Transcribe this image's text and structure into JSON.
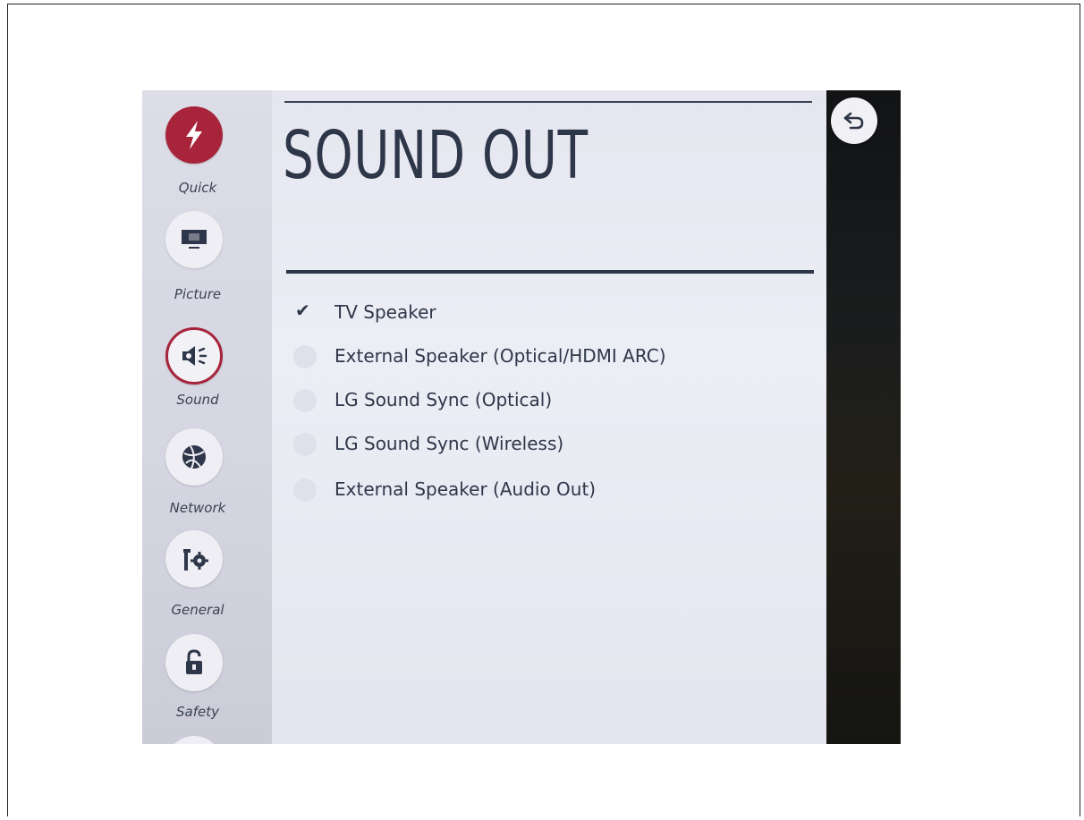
{
  "sidebar": {
    "items": [
      {
        "label": "Quick",
        "icon": "lightning-icon"
      },
      {
        "label": "Picture",
        "icon": "monitor-icon"
      },
      {
        "label": "Sound",
        "icon": "speaker-icon"
      },
      {
        "label": "Network",
        "icon": "globe-icon"
      },
      {
        "label": "General",
        "icon": "wrench-gear-icon"
      },
      {
        "label": "Safety",
        "icon": "lock-icon"
      }
    ],
    "selected": "Sound"
  },
  "panel": {
    "title": "SOUND OUT",
    "options": [
      {
        "label": "TV Speaker",
        "checked": true
      },
      {
        "label": "External Speaker (Optical/HDMI ARC)",
        "checked": false
      },
      {
        "label": "LG Sound Sync (Optical)",
        "checked": false
      },
      {
        "label": "LG Sound Sync (Wireless)",
        "checked": false
      },
      {
        "label": "External Speaker (Audio Out)",
        "checked": false
      }
    ]
  },
  "header": {
    "back_icon": "back-arrow-icon"
  },
  "colors": {
    "accent": "#a7243a",
    "text": "#2e3649",
    "panel_bg": "#e9eaf2"
  }
}
